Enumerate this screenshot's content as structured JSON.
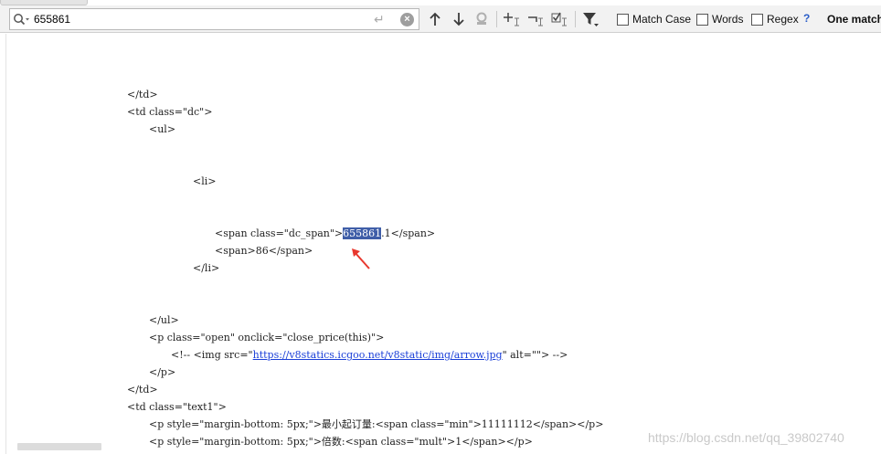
{
  "search": {
    "query": "655861",
    "options": [
      {
        "label": "Match Case",
        "checked": false
      },
      {
        "label": "Words",
        "checked": false
      },
      {
        "label": "Regex",
        "checked": false
      }
    ],
    "help": "?",
    "result": "One match"
  },
  "code": {
    "lines": [
      {
        "indent": 1,
        "text": "</td>"
      },
      {
        "indent": 1,
        "text": "<td class=\"dc\">"
      },
      {
        "indent": 2,
        "text": "<ul>"
      },
      {
        "indent": 4,
        "text": "<li>"
      },
      {
        "indent": 5,
        "prefix": "<span class=\"dc_span\">",
        "match": "655861",
        "suffix": ".1</span>"
      },
      {
        "indent": 5,
        "text": "<span>86</span>"
      },
      {
        "indent": 4,
        "text": "</li>"
      },
      {
        "indent": 2,
        "text": "</ul>"
      },
      {
        "indent": 2,
        "text": "<p class=\"open\" onclick=\"close_price(this)\">"
      },
      {
        "indent": 3,
        "prefix": "<!-- <img src=\"",
        "link": "https://v8statics.icgoo.net/v8static/img/arrow.jpg",
        "suffix": "\" alt=\"\"> -->"
      },
      {
        "indent": 2,
        "text": "</p>"
      },
      {
        "indent": 1,
        "text": "</td>"
      },
      {
        "indent": 1,
        "text": "<td class=\"text1\">"
      },
      {
        "indent": 2,
        "text": "<p style=\"margin-bottom: 5px;\">最小起订量:<span class=\"min\">11111112</span></p>"
      },
      {
        "indent": 2,
        "text": "<p style=\"margin-bottom: 5px;\">倍数:<span class=\"mult\">1</span></p>"
      }
    ]
  },
  "watermark": "https://blog.csdn.net/qq_39802740",
  "colors": {
    "highlight": "#3f5ea8",
    "link": "#1a3fd8",
    "arrow": "#e8382e"
  }
}
